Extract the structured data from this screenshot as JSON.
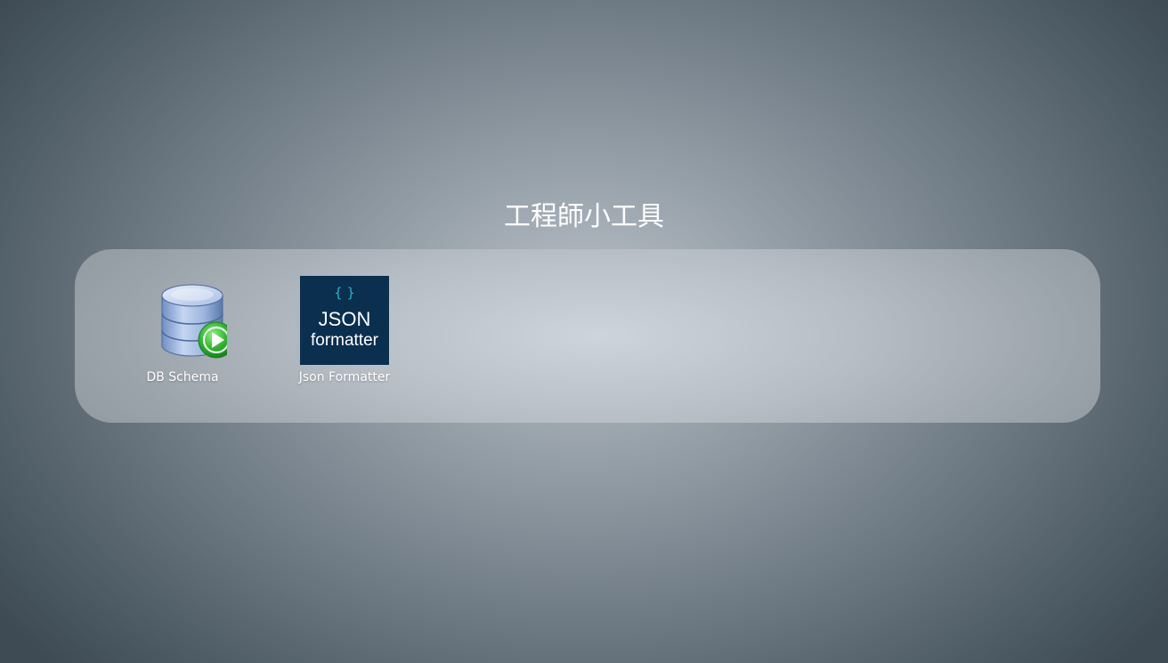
{
  "page": {
    "title": "工程師小工具"
  },
  "apps": [
    {
      "label": "DB Schema",
      "icon": "database-play-icon"
    },
    {
      "label": "Json Formatter",
      "icon": "json-formatter-icon",
      "icon_text": {
        "braces": "{ }",
        "line1": "JSON",
        "line2": "formatter"
      }
    }
  ],
  "colors": {
    "json_tile_bg": "#0b2f4f",
    "json_braces": "#23b7c9",
    "db_cylinder": "#9fb9df",
    "play_badge": "#2fb52f"
  }
}
